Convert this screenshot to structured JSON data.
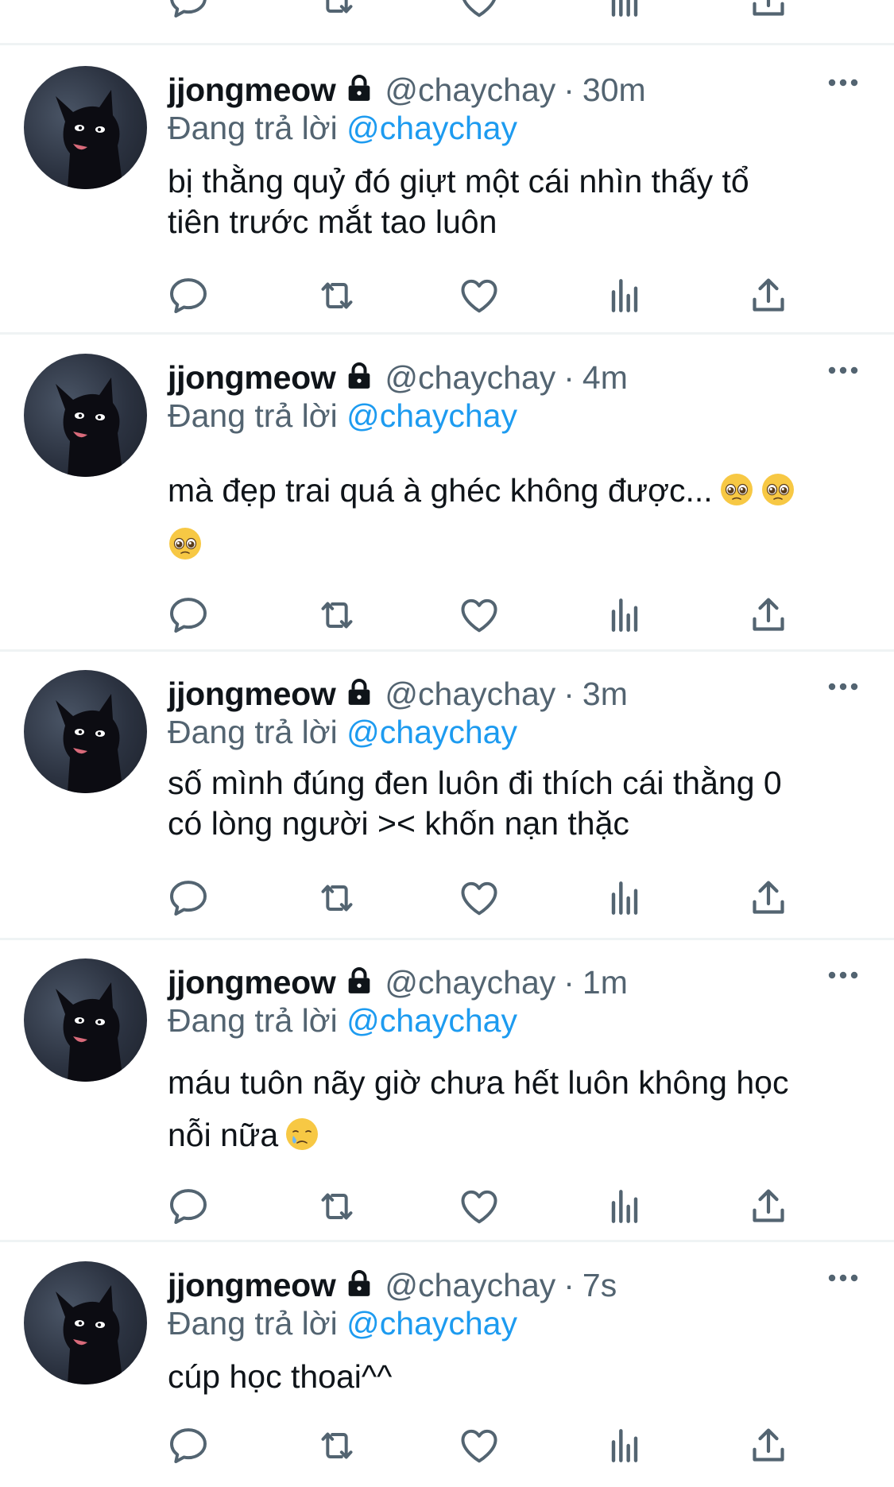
{
  "tweets": [
    {
      "name": "jjongmeow",
      "handle": "@chaychay",
      "separator": "·",
      "time": "30m",
      "reply_prefix": "Đang trả lời",
      "reply_to": "@chaychay",
      "text_lines": [
        "bị thằng quỷ đó giựt một cái nhìn thấy tổ",
        "tiên trước mắt tao luôn"
      ],
      "emoji": []
    },
    {
      "name": "jjongmeow",
      "handle": "@chaychay",
      "separator": "·",
      "time": "4m",
      "reply_prefix": "Đang trả lời",
      "reply_to": "@chaychay",
      "text_lines": [
        "mà đẹp trai quá à ghéc không được..."
      ],
      "emoji": [
        "pleading-face-emoji",
        "pleading-face-emoji",
        "pleading-face-emoji"
      ]
    },
    {
      "name": "jjongmeow",
      "handle": "@chaychay",
      "separator": "·",
      "time": "3m",
      "reply_prefix": "Đang trả lời",
      "reply_to": "@chaychay",
      "text_lines": [
        "số mình đúng đen luôn đi thích cái thằng 0",
        "có lòng người >< khốn nạn thặc"
      ],
      "emoji": []
    },
    {
      "name": "jjongmeow",
      "handle": "@chaychay",
      "separator": "·",
      "time": "1m",
      "reply_prefix": "Đang trả lời",
      "reply_to": "@chaychay",
      "text_lines": [
        "máu tuôn nãy giờ chưa hết luôn không học",
        "nỗi nữa"
      ],
      "emoji": [
        "crying-face-emoji"
      ]
    },
    {
      "name": "jjongmeow",
      "handle": "@chaychay",
      "separator": "·",
      "time": "7s",
      "reply_prefix": "Đang trả lời",
      "reply_to": "@chaychay",
      "text_lines": [
        "cúp học thoai^^"
      ],
      "emoji": []
    }
  ],
  "action_icons": [
    "reply-icon",
    "retweet-icon",
    "like-icon",
    "analytics-icon",
    "share-icon"
  ],
  "colors": {
    "accent": "#1d9bf0",
    "secondary_text": "#536471",
    "primary_text": "#0f1419",
    "divider": "#eff3f4",
    "icon": "#536471",
    "emoji_yellow": "#f7c844"
  }
}
